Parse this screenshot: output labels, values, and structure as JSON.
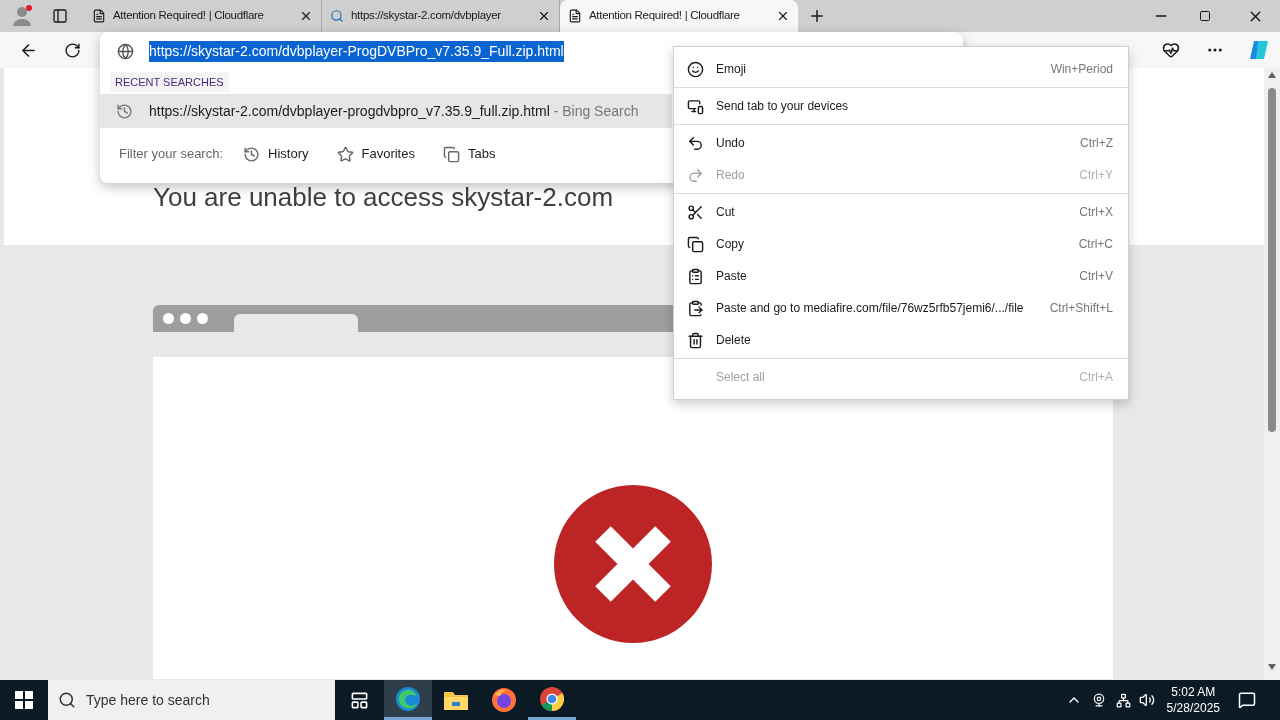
{
  "tabs": [
    {
      "title": "Attention Required! | Cloudflare",
      "kind": "page",
      "selected": false
    },
    {
      "title": "https://skystar-2.com/dvbplayer",
      "kind": "search",
      "selected": false
    },
    {
      "title": "Attention Required! | Cloudflare",
      "kind": "page",
      "selected": true
    }
  ],
  "address": {
    "value": "https://skystar-2.com/dvbplayer-ProgDVBPro_v7.35.9_Full.zip.html",
    "selected_text": true
  },
  "suggestions": {
    "heading": "RECENT SEARCHES",
    "items": [
      {
        "text": "https://skystar-2.com/dvbplayer-progdvbpro_v7.35.9_full.zip.html",
        "suffix": " - Bing Search",
        "selected": true
      }
    ],
    "filter_label": "Filter your search:",
    "filters": [
      {
        "label": "History"
      },
      {
        "label": "Favorites"
      },
      {
        "label": "Tabs"
      }
    ]
  },
  "page": {
    "heading": "You are unable to access skystar-2.com"
  },
  "context_menu": {
    "groups": [
      [
        {
          "label": "Emoji",
          "shortcut": "Win+Period",
          "disabled": false
        }
      ],
      [
        {
          "label": "Send tab to your devices",
          "disabled": false
        }
      ],
      [
        {
          "label": "Undo",
          "shortcut": "Ctrl+Z",
          "disabled": false
        },
        {
          "label": "Redo",
          "shortcut": "Ctrl+Y",
          "disabled": true
        }
      ],
      [
        {
          "label": "Cut",
          "shortcut": "Ctrl+X",
          "disabled": false
        },
        {
          "label": "Copy",
          "shortcut": "Ctrl+C",
          "disabled": false
        },
        {
          "label": "Paste",
          "shortcut": "Ctrl+V",
          "disabled": false
        },
        {
          "label": "Paste and go to mediafire.com/file/76wz5rfb57jemi6/.../file",
          "shortcut": "Ctrl+Shift+L",
          "disabled": false
        },
        {
          "label": "Delete",
          "disabled": false
        }
      ],
      [
        {
          "label": "Select all",
          "shortcut": "Ctrl+A",
          "disabled": true
        }
      ]
    ]
  },
  "taskbar": {
    "search_placeholder": "Type here to search",
    "apps": [
      {
        "active": true
      },
      {
        "active": false
      },
      {
        "active": false
      },
      {
        "active": true
      }
    ],
    "time": "5:02 AM",
    "date": "5/28/2025"
  }
}
